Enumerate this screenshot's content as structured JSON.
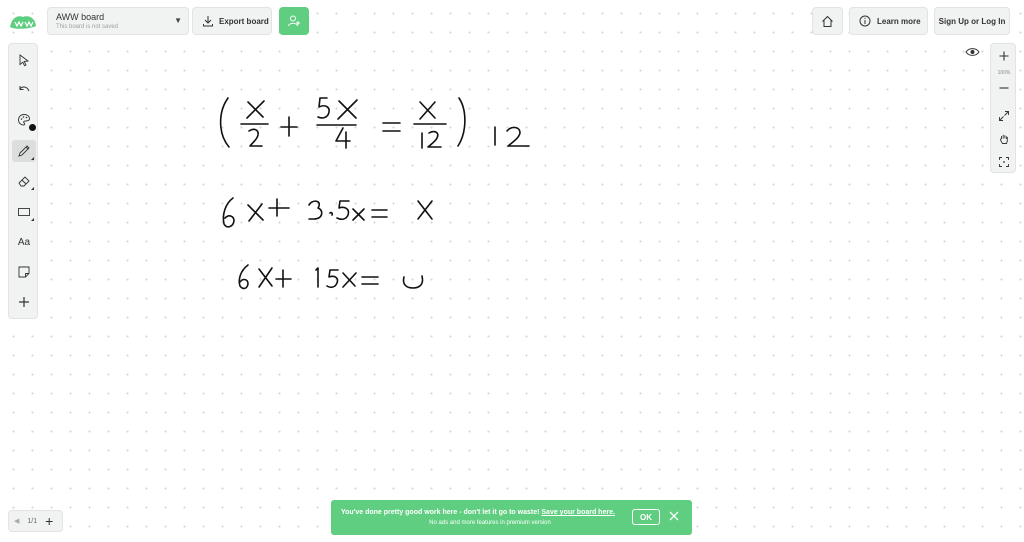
{
  "header": {
    "board_title": "AWW board",
    "board_subtitle": "This board is not saved",
    "export_label": "Export board",
    "learn_more_label": "Learn more",
    "signup_label": "Sign Up or Log In"
  },
  "toolbar": {
    "tools": [
      {
        "name": "select",
        "icon": "cursor-icon"
      },
      {
        "name": "undo",
        "icon": "undo-icon"
      },
      {
        "name": "color",
        "icon": "palette-icon"
      },
      {
        "name": "pen",
        "icon": "pencil-icon",
        "active": true
      },
      {
        "name": "eraser",
        "icon": "eraser-icon"
      },
      {
        "name": "shape",
        "icon": "rectangle-icon"
      },
      {
        "name": "text",
        "label": "Aa"
      },
      {
        "name": "sticky-note",
        "icon": "sticky-note-icon"
      },
      {
        "name": "add",
        "icon": "plus-icon"
      }
    ]
  },
  "zoom": {
    "level": "100%"
  },
  "pager": {
    "label": "1/1"
  },
  "toast": {
    "message": "You've done pretty good work here - don't let it go to waste!",
    "link": "Save your board here.",
    "sub": "No ads and more features in premium version",
    "ok_label": "OK"
  },
  "colors": {
    "accent": "#5fce80",
    "panel": "#f1f2f2",
    "ink": "#111111"
  }
}
